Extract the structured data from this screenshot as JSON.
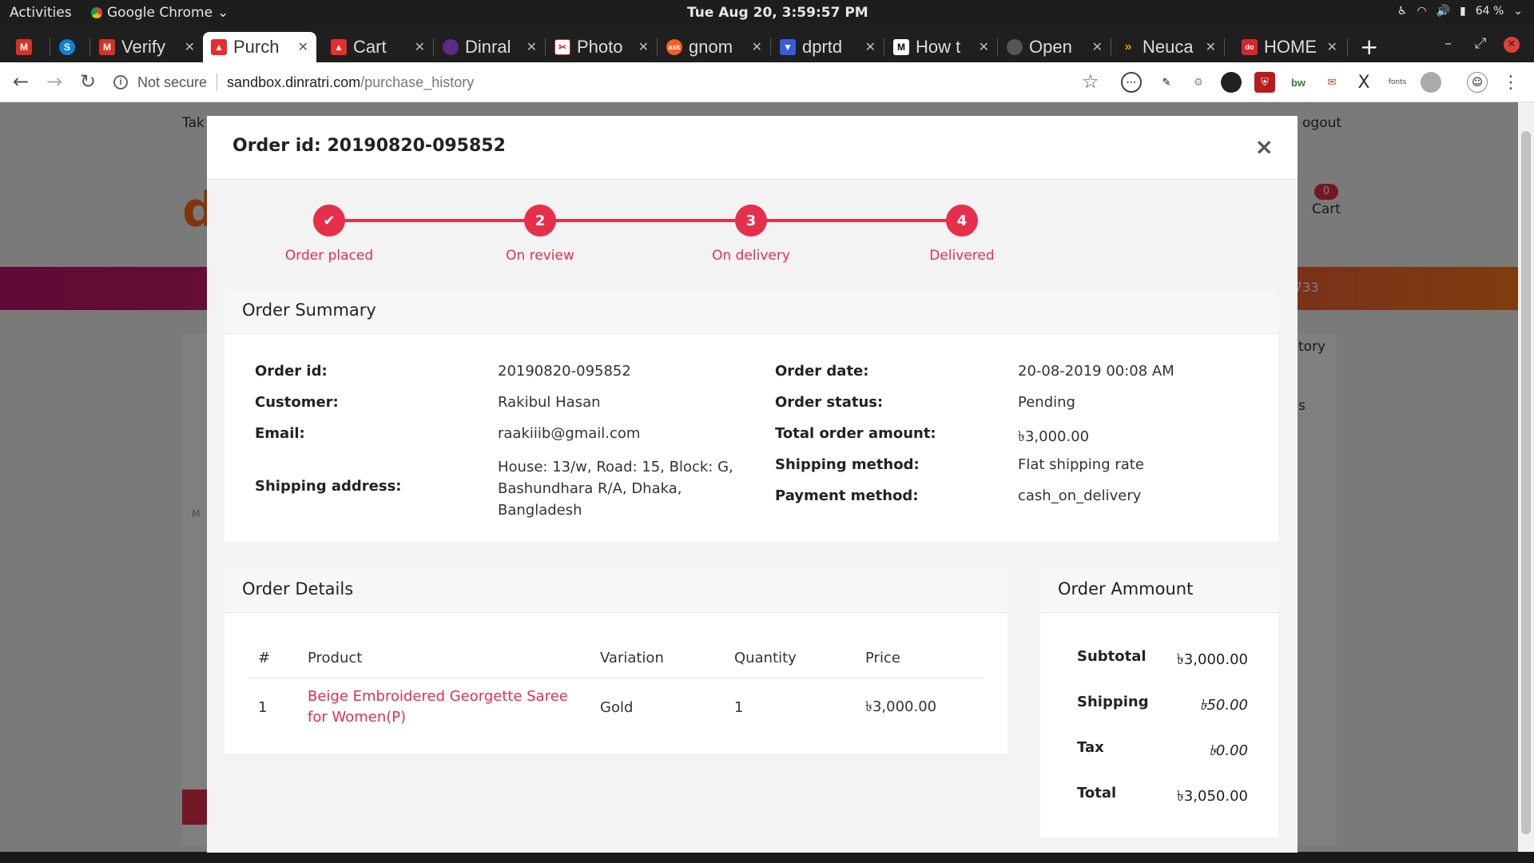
{
  "system": {
    "activities": "Activities",
    "app_name": "Google Chrome",
    "clock": "Tue Aug 20,  3:59:57 PM",
    "battery": "64 %"
  },
  "browser": {
    "tabs": [
      {
        "label": "",
        "icon": "gmail-icon",
        "color": "#d93025"
      },
      {
        "label": "S",
        "icon": "skype-icon",
        "color": "#0a84d6"
      },
      {
        "label": "Verify",
        "icon": "gmail-icon",
        "color": "#d93025"
      },
      {
        "label": "Purch",
        "icon": "bag-icon",
        "color": "#e62e2e",
        "active": true
      },
      {
        "label": "Cart",
        "icon": "bag-icon",
        "color": "#e62e2e"
      },
      {
        "label": "Dinral",
        "icon": "dinratri-icon",
        "color": "#5b2c83"
      },
      {
        "label": "Photo",
        "icon": "scissors-icon",
        "color": "#d6262b"
      },
      {
        "label": "gnom",
        "icon": "ask-icon",
        "color": "#f25e1f"
      },
      {
        "label": "dprtd",
        "icon": "shield-icon",
        "color": "#3b5bdb"
      },
      {
        "label": "How t",
        "icon": "medium-icon",
        "color": "#000000"
      },
      {
        "label": "Open",
        "icon": "globe-icon",
        "color": "#555555"
      },
      {
        "label": "Neuca",
        "icon": "neuca-icon",
        "color": "#d4a300"
      },
      {
        "label": "HOME",
        "icon": "home-logo-icon",
        "color": "#d6262b"
      }
    ],
    "address": {
      "security": "Not secure",
      "host": "sandbox.dinratri.com",
      "path": "/purchase_history"
    }
  },
  "background": {
    "top_left_text": "Tak",
    "top_right_text": "ogout",
    "cart_count": "0",
    "cart_label": "Cart",
    "band_text": "733",
    "side_text": "tory",
    "side_text2": "s",
    "left_text": "M"
  },
  "modal": {
    "title": "Order id: 20190820-095852",
    "close": "×",
    "steps": [
      {
        "marker": "✔",
        "label": "Order placed"
      },
      {
        "marker": "2",
        "label": "On review"
      },
      {
        "marker": "3",
        "label": "On delivery"
      },
      {
        "marker": "4",
        "label": "Delivered"
      }
    ],
    "summary": {
      "heading": "Order Summary",
      "left": [
        {
          "key": "Order id:",
          "value": "20190820-095852"
        },
        {
          "key": "Customer:",
          "value": "Rakibul Hasan"
        },
        {
          "key": "Email:",
          "value": "raakiiib@gmail.com"
        },
        {
          "key": "Shipping address:",
          "value": "House: 13/w, Road: 15, Block: G, Bashundhara R/A, Dhaka, Bangladesh"
        }
      ],
      "right": [
        {
          "key": "Order date:",
          "value": "20-08-2019 00:08 AM"
        },
        {
          "key": "Order status:",
          "value": "Pending"
        },
        {
          "key": "Total order amount:",
          "value": "৳3,000.00"
        },
        {
          "key": "Shipping method:",
          "value": "Flat shipping rate"
        },
        {
          "key": "Payment method:",
          "value": "cash_on_delivery"
        }
      ]
    },
    "details": {
      "heading": "Order Details",
      "columns": [
        "#",
        "Product",
        "Variation",
        "Quantity",
        "Price"
      ],
      "rows": [
        {
          "num": "1",
          "product": "Beige Embroidered Georgette Saree for Women(P)",
          "variation": "Gold",
          "quantity": "1",
          "price": "৳3,000.00"
        }
      ]
    },
    "amount": {
      "heading": "Order Ammount",
      "rows": [
        {
          "key": "Subtotal",
          "value": "৳3,000.00",
          "italic": false
        },
        {
          "key": "Shipping",
          "value": "৳50.00",
          "italic": true
        },
        {
          "key": "Tax",
          "value": "৳0.00",
          "italic": true
        },
        {
          "key": "Total",
          "value": "৳3,050.00",
          "italic": false
        }
      ]
    }
  },
  "colors": {
    "accent": "#e62e4d"
  }
}
